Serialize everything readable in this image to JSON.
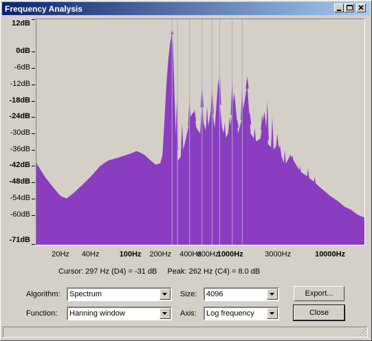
{
  "window": {
    "title": "Frequency Analysis"
  },
  "colors": {
    "spectrum_fill": "#8a3dc1",
    "titlebar_start": "#0a246a",
    "titlebar_end": "#a6caf0"
  },
  "chart_data": {
    "type": "area",
    "xscale": "log",
    "xlim": [
      11.5,
      22050
    ],
    "ylim": [
      -71,
      12
    ],
    "x_ticks": [
      "20Hz",
      "40Hz",
      "100Hz",
      "200Hz",
      "400Hz",
      "600Hz",
      "1000Hz",
      "3000Hz",
      "10000Hz"
    ],
    "y_ticks": [
      "12dB",
      "0dB",
      "-6dB",
      "-12dB",
      "-18dB",
      "-24dB",
      "-30dB",
      "-36dB",
      "-42dB",
      "-48dB",
      "-54dB",
      "-60dB",
      "-71dB"
    ],
    "envelope": [
      [
        11.5,
        -41
      ],
      [
        14,
        -46
      ],
      [
        17,
        -50
      ],
      [
        20,
        -53
      ],
      [
        23,
        -54
      ],
      [
        27,
        -52
      ],
      [
        33,
        -49
      ],
      [
        40,
        -46
      ],
      [
        50,
        -42
      ],
      [
        60,
        -40
      ],
      [
        75,
        -39
      ],
      [
        90,
        -38
      ],
      [
        100,
        -37.5
      ],
      [
        115,
        -36.5
      ],
      [
        125,
        -37
      ],
      [
        140,
        -38
      ],
      [
        160,
        -40
      ],
      [
        180,
        -41.5
      ],
      [
        200,
        -41
      ],
      [
        210,
        -38
      ],
      [
        220,
        -25
      ],
      [
        230,
        -12
      ],
      [
        240,
        -3
      ],
      [
        250,
        3
      ],
      [
        258,
        6
      ],
      [
        262,
        8
      ],
      [
        267,
        3
      ],
      [
        275,
        -12
      ],
      [
        285,
        -30
      ],
      [
        300,
        -40
      ],
      [
        330,
        -38
      ],
      [
        360,
        -32
      ],
      [
        380,
        -28
      ],
      [
        400,
        -24
      ],
      [
        430,
        -22
      ],
      [
        460,
        -28
      ],
      [
        500,
        -30
      ],
      [
        525,
        -18
      ],
      [
        540,
        -26
      ],
      [
        580,
        -30
      ],
      [
        620,
        -25
      ],
      [
        650,
        -20
      ],
      [
        700,
        -28
      ],
      [
        760,
        -10
      ],
      [
        790,
        -20
      ],
      [
        830,
        -28
      ],
      [
        900,
        -32
      ],
      [
        1000,
        -28
      ],
      [
        1100,
        -15
      ],
      [
        1200,
        -30
      ],
      [
        1300,
        -25
      ],
      [
        1480,
        -12
      ],
      [
        1600,
        -30
      ],
      [
        1800,
        -33
      ],
      [
        2000,
        -32
      ],
      [
        2200,
        -22
      ],
      [
        2400,
        -34
      ],
      [
        2700,
        -36
      ],
      [
        3000,
        -34
      ],
      [
        3500,
        -42
      ],
      [
        4000,
        -38
      ],
      [
        5000,
        -44
      ],
      [
        6000,
        -46
      ],
      [
        7000,
        -48
      ],
      [
        8000,
        -50
      ],
      [
        10000,
        -53
      ],
      [
        12000,
        -55
      ],
      [
        14000,
        -57
      ],
      [
        16000,
        -58
      ],
      [
        19000,
        -60
      ],
      [
        22050,
        -61
      ]
    ],
    "peaks": [
      [
        262,
        8
      ],
      [
        292,
        -18
      ],
      [
        330,
        -26
      ],
      [
        392,
        -17
      ],
      [
        440,
        -21
      ],
      [
        494,
        -30
      ],
      [
        523,
        -12
      ],
      [
        587,
        -20
      ],
      [
        659,
        -12
      ],
      [
        784,
        -6
      ],
      [
        880,
        -26
      ],
      [
        988,
        -24
      ],
      [
        1047,
        -9
      ],
      [
        1175,
        -25
      ],
      [
        1319,
        -13
      ],
      [
        1480,
        -9
      ],
      [
        1568,
        -22
      ],
      [
        1760,
        -28
      ],
      [
        2093,
        -23
      ],
      [
        2350,
        -18
      ],
      [
        2637,
        -24
      ],
      [
        2960,
        -30
      ],
      [
        3136,
        -34
      ],
      [
        3520,
        -36
      ],
      [
        4186,
        -38
      ],
      [
        5000,
        -42
      ],
      [
        6000,
        -43
      ],
      [
        7000,
        -46
      ]
    ],
    "marker_lines_hz": [
      297,
      262,
      392,
      523,
      659,
      784,
      1047,
      1319
    ]
  },
  "status": {
    "cursor": "Cursor: 297 Hz (D4) = -31 dB",
    "peak": "Peak: 262 Hz (C4) = 8.0 dB"
  },
  "controls": {
    "algorithm_label": "Algorithm:",
    "algorithm_value": "Spectrum",
    "size_label": "Size:",
    "size_value": "4096",
    "function_label": "Function:",
    "function_value": "Hanning window",
    "axis_label": "Axis:",
    "axis_value": "Log frequency",
    "export_label": "Export...",
    "close_label": "Close"
  }
}
